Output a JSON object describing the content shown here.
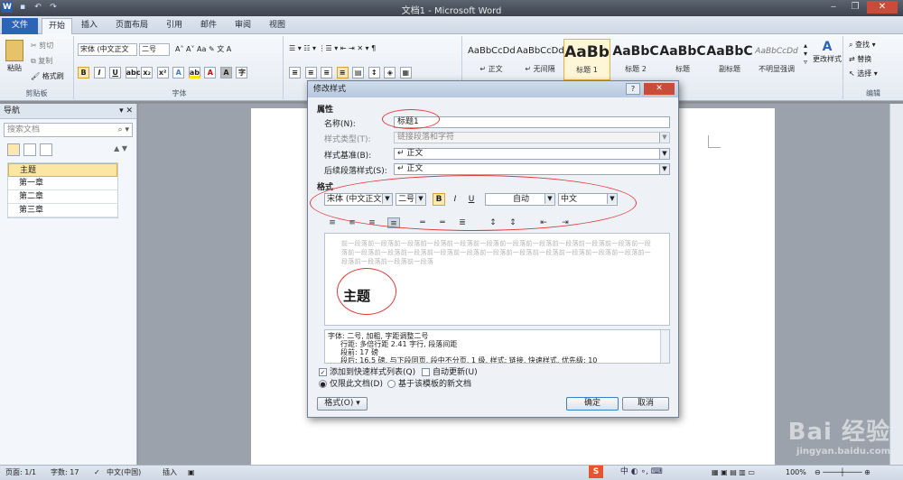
{
  "window": {
    "title": "文档1 - Microsoft Word"
  },
  "tabs": [
    {
      "label": "文件"
    },
    {
      "label": "开始"
    },
    {
      "label": "插入"
    },
    {
      "label": "页面布局"
    },
    {
      "label": "引用"
    },
    {
      "label": "邮件"
    },
    {
      "label": "审阅"
    },
    {
      "label": "视图"
    }
  ],
  "ribbon": {
    "clipboard": {
      "paste": "粘贴",
      "cut": "剪切",
      "copy": "复制",
      "format_painter": "格式刷",
      "label": "剪贴板"
    },
    "font": {
      "name": "宋体 (中文正文",
      "size": "二号",
      "label": "字体"
    },
    "paragraph": {
      "label": "段落"
    },
    "styles": {
      "items": [
        {
          "preview": "AaBbCcDd",
          "name": "↵ 正文"
        },
        {
          "preview": "AaBbCcDd",
          "name": "↵ 无间隔"
        },
        {
          "preview": "AaBb",
          "name": "标题 1"
        },
        {
          "preview": "AaBbC",
          "name": "标题 2"
        },
        {
          "preview": "AaBbC",
          "name": "标题"
        },
        {
          "preview": "AaBbC",
          "name": "副标题"
        },
        {
          "preview": "AaBbCcDd",
          "name": "不明显强调"
        }
      ],
      "change_styles": "更改样式",
      "label": "样式"
    },
    "editing": {
      "find": "查找",
      "replace": "替换",
      "select": "选择",
      "label": "编辑"
    }
  },
  "nav": {
    "title": "导航",
    "search_placeholder": "搜索文档",
    "items": [
      "主题",
      "第一章",
      "第二章",
      "第三章"
    ]
  },
  "dialog": {
    "title": "修改样式",
    "properties_label": "属性",
    "name_label": "名称(N):",
    "name_value": "标题1",
    "type_label": "样式类型(T):",
    "type_value": "链接段落和字符",
    "based_label": "样式基准(B):",
    "based_value": "↵ 正文",
    "next_label": "后续段落样式(S):",
    "next_value": "↵ 正文",
    "format_label": "格式",
    "font_name": "宋体 (中文正文",
    "font_size": "二号",
    "bold": "B",
    "italic": "I",
    "underline": "U",
    "color": "自动",
    "lang": "中文",
    "preview_prev": "前一段落前一段落前一段落前一段落前一段落前一段落前一段落前一段落前一段落前一段落前一段落前一段落前一段落前一段落前一段落前一段落前一段落前一段落前一段落前一段落前一段落前一段落前一段落前一段落前一段落前一段落前一段落",
    "preview_heading": "主题",
    "desc_line1": "字体: 二号, 加粗, 字距调整二号",
    "desc_line2": "行距: 多倍行距 2.41 字行, 段落间距",
    "desc_line3": "段前: 17 磅",
    "desc_line4": "段后: 16.5 磅, 与下段同页, 段中不分页, 1 级, 样式: 链接, 快速样式, 优先级: 10",
    "add_quick": "添加到快速样式列表(Q)",
    "auto_update": "自动更新(U)",
    "only_doc": "仅限此文档(D)",
    "template_doc": "基于该模板的新文档",
    "format_btn": "格式(O) ▾",
    "ok": "确定",
    "cancel": "取消"
  },
  "status": {
    "page": "页面: 1/1",
    "words": "字数: 17",
    "lang": "中文(中国)",
    "mode": "插入",
    "zoom": "100%"
  },
  "watermark": {
    "big": "Bai 经验",
    "small": "jingyan.baidu.com"
  },
  "ime": {
    "label": "中 ◐ ∘, ⌨"
  }
}
